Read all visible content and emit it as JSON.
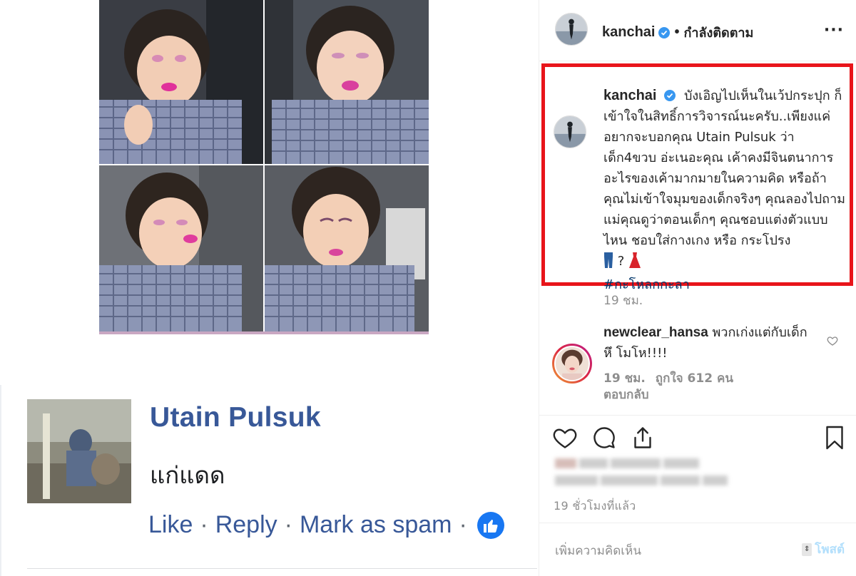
{
  "facebook": {
    "photos": [
      {
        "icon": "child-selfie-photo"
      },
      {
        "icon": "child-selfie-photo"
      },
      {
        "icon": "child-selfie-photo"
      },
      {
        "icon": "child-selfie-photo"
      }
    ],
    "comment": {
      "author": "Utain Pulsuk",
      "text": "แก่แดด",
      "actions": {
        "like": "Like",
        "reply": "Reply",
        "spam": "Mark as spam",
        "separator": "·"
      },
      "reaction_icon": "thumbs-up-icon"
    },
    "colors": {
      "link": "#385898",
      "reaction": "#1877f2"
    }
  },
  "instagram": {
    "header": {
      "username": "kanchai",
      "dot": "•",
      "following": "กำลังติดตาม",
      "more": "···"
    },
    "caption": {
      "username": "kanchai",
      "text": "บังเอิญไปเห็นในเว้ปกระปุก ก็เข้าใจในสิทธิ์การวิจารณ์นะครับ..เพียงแค่อยากจะบอกคุณ Utain Pulsuk ว่าเด็ก4ขวบ อ่ะเนอะคุณ เค้าคงมีจินตนาการอะไรของเค้ามากมายในความคิด หรือถ้าคุณไม่เข้าใจมุมของเด็กจริงๆ คุณลองไปถามแม่คุณดูว่าตอนเด็กๆ คุณชอบแต่งตัวแบบไหน ชอบใส่กางเกง หรือ กระโปรง",
      "question_mark": "?",
      "emoji_1": "jeans-icon",
      "emoji_2": "dress-icon",
      "hashtag": "#กะโหลกกะลา",
      "time": "19 ชม."
    },
    "comment": {
      "username": "newclear_hansa",
      "text": "พวกเก่งแต่กับเด็ก หึ โมโห!!!!",
      "time": "19 ชม.",
      "likes": "ถูกใจ 612 คน",
      "reply": "ตอบกลับ"
    },
    "post_time": "19 ชั่วโมงที่แล้ว",
    "add_comment_placeholder": "เพิ่มความคิดเห็น",
    "post_button": "โพสต์",
    "colors": {
      "highlight_border": "#e8141a",
      "verified": "#3897f0",
      "hashtag": "#003569",
      "muted": "#8e8e8e"
    }
  }
}
